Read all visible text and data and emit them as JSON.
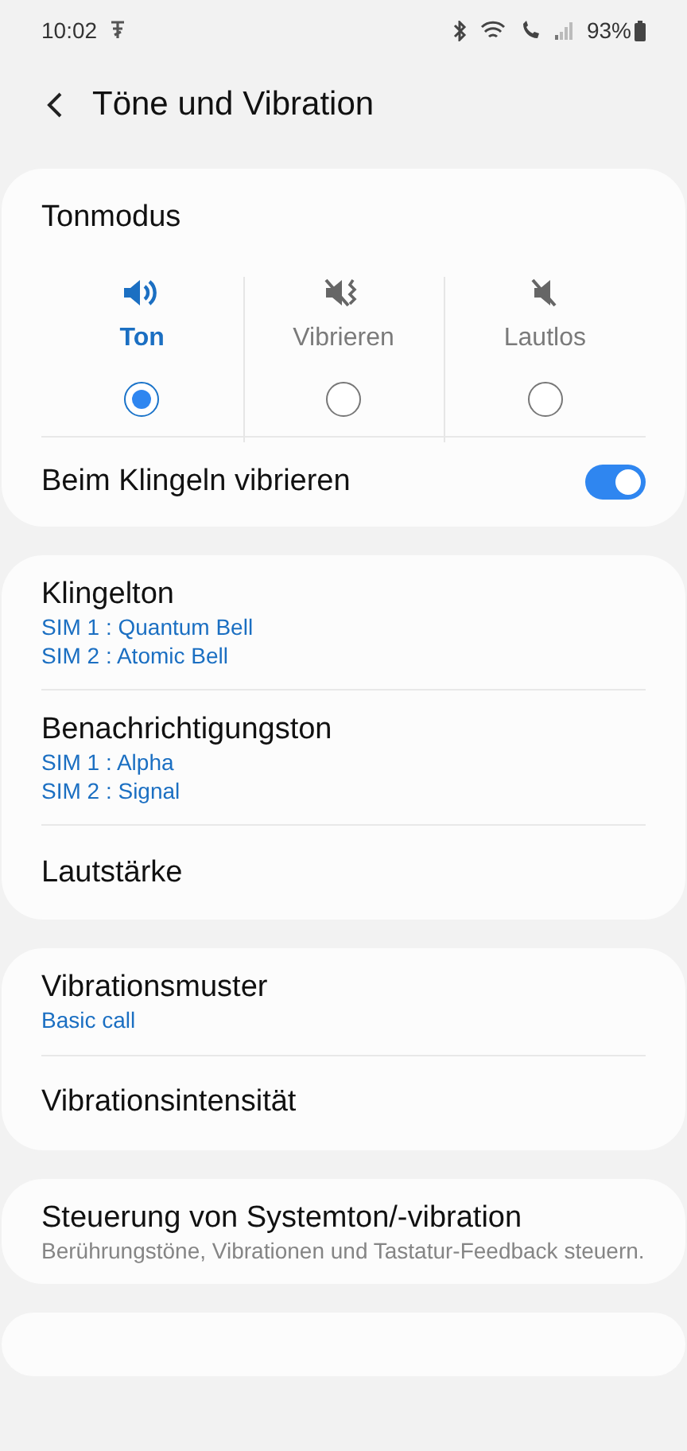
{
  "status_bar": {
    "time": "10:02",
    "battery": "93%"
  },
  "header": {
    "title": "Töne und Vibration"
  },
  "sound_mode": {
    "title": "Tonmodus",
    "options": [
      {
        "kind": "sound",
        "label": "Ton",
        "selected": true
      },
      {
        "kind": "vibrate",
        "label": "Vibrieren",
        "selected": false
      },
      {
        "kind": "mute",
        "label": "Lautlos",
        "selected": false
      }
    ],
    "vibrate_toggle": {
      "label": "Beim Klingeln vibrieren",
      "on": true
    }
  },
  "groups": [
    {
      "items": [
        {
          "title": "Klingelton",
          "subtitles": [
            {
              "kind": "value",
              "text": "SIM 1 : Quantum Bell"
            },
            {
              "kind": "value",
              "text": "SIM 2 : Atomic Bell"
            }
          ]
        },
        {
          "title": "Benachrichtigungston",
          "subtitles": [
            {
              "kind": "value",
              "text": "SIM 1 : Alpha"
            },
            {
              "kind": "value",
              "text": "SIM 2 : Signal"
            }
          ]
        },
        {
          "title": "Lautstärke"
        }
      ]
    },
    {
      "items": [
        {
          "title": "Vibrationsmuster",
          "subtitles": [
            {
              "kind": "value",
              "text": "Basic call"
            }
          ]
        },
        {
          "title": "Vibrationsintensität"
        }
      ]
    },
    {
      "items": [
        {
          "title": "Steuerung von Systemton/-vibration",
          "subtitles": [
            {
              "kind": "description",
              "text": "Berührungstöne, Vibrationen und Tastatur-Feedback steuern."
            }
          ]
        }
      ]
    }
  ]
}
